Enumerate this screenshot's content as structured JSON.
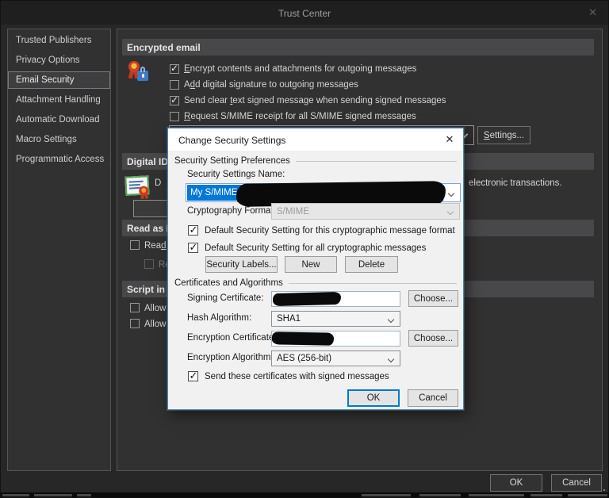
{
  "window": {
    "title": "Trust Center",
    "close_icon": "✕"
  },
  "sidebar": {
    "items": [
      {
        "label": "Trusted Publishers",
        "selected": false
      },
      {
        "label": "Privacy Options",
        "selected": false
      },
      {
        "label": "Email Security",
        "selected": true
      },
      {
        "label": "Attachment Handling",
        "selected": false
      },
      {
        "label": "Automatic Download",
        "selected": false
      },
      {
        "label": "Macro Settings",
        "selected": false
      },
      {
        "label": "Programmatic Access",
        "selected": false
      }
    ]
  },
  "content": {
    "encrypted_email": {
      "header": "Encrypted email",
      "checkboxes": [
        {
          "checked": true,
          "pre": "",
          "key": "E",
          "post": "ncrypt contents and attachments for outgoing messages"
        },
        {
          "checked": false,
          "pre": "A",
          "key": "d",
          "post": "d digital signature to outgoing messages"
        },
        {
          "checked": true,
          "pre": "Send clear ",
          "key": "t",
          "post": "ext signed message when sending signed messages"
        },
        {
          "checked": false,
          "pre": "",
          "key": "R",
          "post": "equest S/MIME receipt for all S/MIME signed messages"
        }
      ],
      "settings_button": {
        "pre": "",
        "key": "S",
        "post": "ettings..."
      }
    },
    "digital_ids": {
      "header_fragment": "Digital IDs",
      "body_left_fragment": "D",
      "body_right_fragment": "electronic transactions."
    },
    "read_as_plain": {
      "header_fragment": "Read as Pla",
      "checkbox": {
        "checked": false,
        "pre": "Rea",
        "key": "d",
        "post": " a"
      },
      "checkbox2_fragment": "Re",
      "checkbox2_checked": false
    },
    "script_in_folders": {
      "header_fragment": "Script in F",
      "checkbox1_checked": false,
      "checkbox1_fragment": "Allow",
      "checkbox2_checked": false,
      "checkbox2_fragment": "Allow"
    },
    "footer": {
      "ok_label": "OK",
      "cancel_label": "Cancel"
    }
  },
  "dialog": {
    "title": "Change Security Settings",
    "close_icon": "✕",
    "preferences": {
      "group_label": "Security Setting Preferences",
      "name_label": "Security Settings Name:",
      "name_value": "My S/MIME Settings (",
      "name_value_redacted": true,
      "crypto_label": "Cryptography Format:",
      "crypto_value": "S/MIME",
      "cb_this_format": {
        "checked": true,
        "label": "Default Security Setting for this cryptographic message format"
      },
      "cb_all_messages": {
        "checked": true,
        "label": "Default Security Setting for all cryptographic messages"
      },
      "security_labels_button": "Security Labels...",
      "new_button": "New",
      "delete_button": "Delete"
    },
    "certificates": {
      "group_label": "Certificates and Algorithms",
      "signing_label": "Signing Certificate:",
      "signing_value_redacted": true,
      "choose_button": "Choose...",
      "hash_label": "Hash Algorithm:",
      "hash_value": "SHA1",
      "enc_cert_label": "Encryption Certificate:",
      "enc_cert_value_redacted": true,
      "choose_button2": "Choose...",
      "enc_alg_label": "Encryption Algorithm:",
      "enc_alg_value": "AES (256-bit)",
      "cb_send_certs": {
        "checked": true,
        "label": "Send these certificates with signed messages"
      }
    },
    "ok_label": "OK",
    "cancel_label": "Cancel"
  },
  "colors": {
    "selection_blue": "#0078d7",
    "dialog_border": "#4d86ae",
    "redaction_black": "#0a0a0a",
    "sidebar_selected_bg": "#3e3e40",
    "panel_bg": "#313131",
    "header_bar_bg": "#48484a"
  }
}
